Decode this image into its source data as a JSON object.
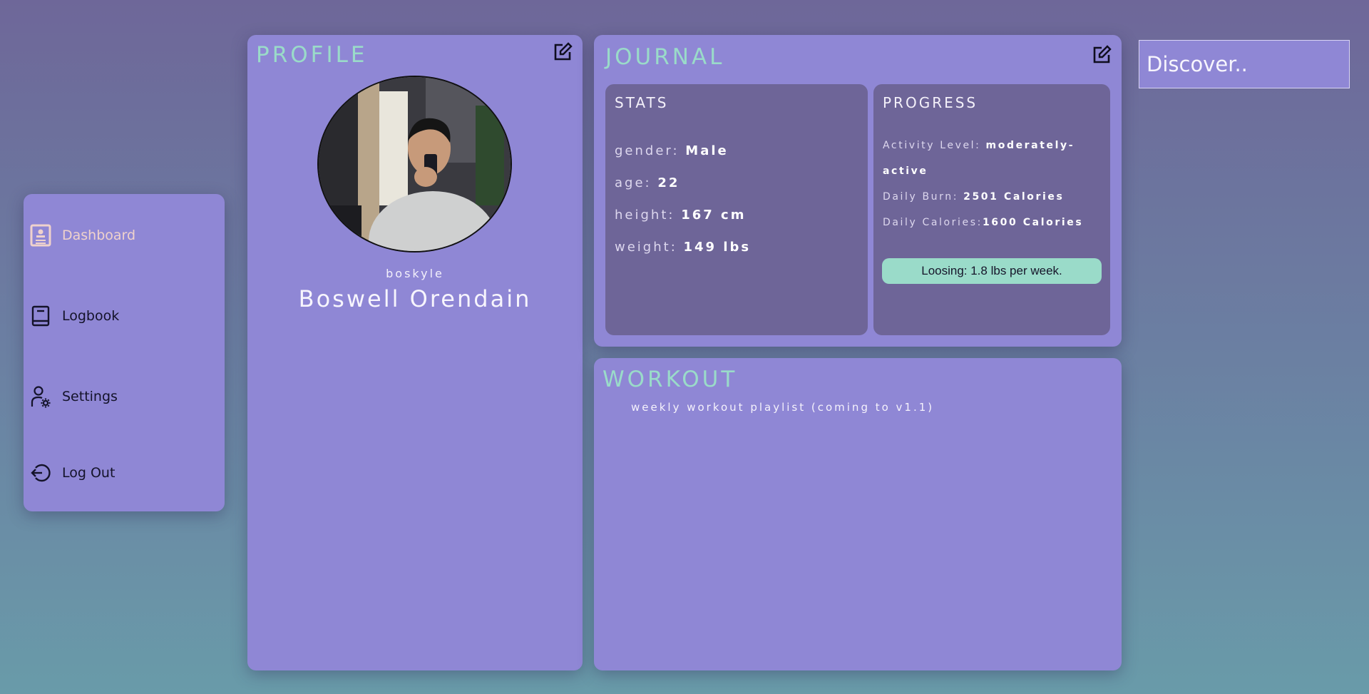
{
  "sidebar": {
    "items": [
      {
        "label": "Dashboard",
        "icon": "dashboard-icon",
        "active": true
      },
      {
        "label": "Logbook",
        "icon": "book-icon"
      },
      {
        "label": "Settings",
        "icon": "user-settings-icon"
      },
      {
        "label": "Log Out",
        "icon": "logout-icon"
      }
    ]
  },
  "profile": {
    "title": "PROFILE",
    "username": "boskyle",
    "full_name": "Boswell Orendain",
    "edit_icon": "edit-icon"
  },
  "journal": {
    "title": "JOURNAL",
    "edit_icon": "edit-icon",
    "stats": {
      "title": "STATS",
      "gender_label": "gender:",
      "gender_value": "Male",
      "age_label": "age:",
      "age_value": "22",
      "height_label": "height:",
      "height_value": "167 cm",
      "weight_label": "weight:",
      "weight_value": "149 lbs"
    },
    "progress": {
      "title": "PROGRESS",
      "activity_label": "Activity Level:",
      "activity_value": "moderately-active",
      "burn_label": "Daily Burn:",
      "burn_value": "2501 Calories",
      "calories_label": "Daily Calories:",
      "calories_value": "1600 Calories",
      "goal_text": "Loosing: 1.8 lbs per week."
    }
  },
  "workout": {
    "title": "WORKOUT",
    "subtitle": "weekly workout playlist (coming to v1.1)"
  },
  "discover": {
    "placeholder": "Discover.."
  },
  "colors": {
    "card": "#8f87d5",
    "subpanel": "#6e6598",
    "accent_teal": "#9adbc9",
    "active_nav": "#efd2cc"
  }
}
